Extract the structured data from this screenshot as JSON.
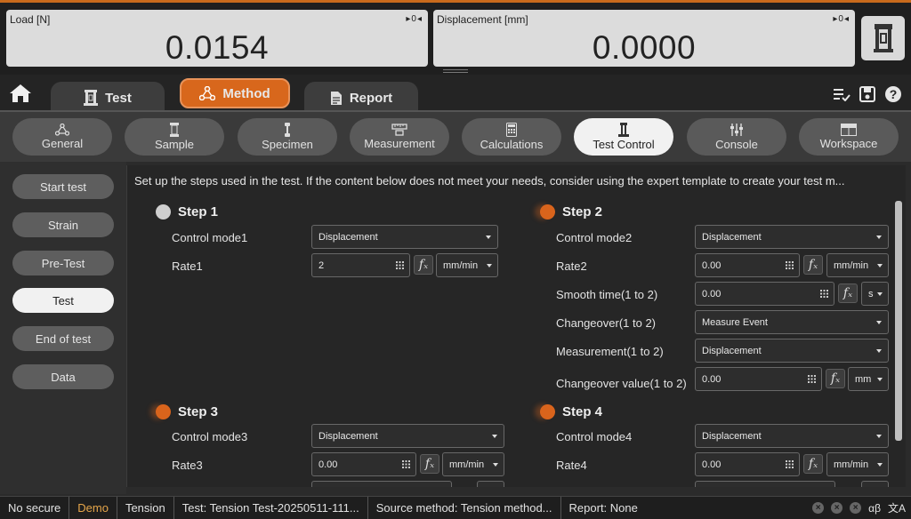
{
  "readouts": {
    "load": {
      "label": "Load [N]",
      "value": "0.0154",
      "controls": "▸0◂"
    },
    "displacement": {
      "label": "Displacement [mm]",
      "value": "0.0000",
      "controls": "▸0◂"
    }
  },
  "main_tabs": [
    {
      "label": "Test",
      "icon": "test-machine-icon",
      "active": false
    },
    {
      "label": "Method",
      "icon": "method-icon",
      "active": true
    },
    {
      "label": "Report",
      "icon": "report-icon",
      "active": false
    }
  ],
  "sub_tabs": [
    {
      "label": "General",
      "icon": "general-icon"
    },
    {
      "label": "Sample",
      "icon": "sample-icon"
    },
    {
      "label": "Specimen",
      "icon": "specimen-icon"
    },
    {
      "label": "Measurement",
      "icon": "measurement-icon"
    },
    {
      "label": "Calculations",
      "icon": "calculator-icon"
    },
    {
      "label": "Test Control",
      "icon": "test-control-icon",
      "active": true
    },
    {
      "label": "Console",
      "icon": "console-icon"
    },
    {
      "label": "Workspace",
      "icon": "workspace-icon"
    }
  ],
  "left_nav": [
    {
      "label": "Start test"
    },
    {
      "label": "Strain"
    },
    {
      "label": "Pre-Test"
    },
    {
      "label": "Test",
      "active": true
    },
    {
      "label": "End of test"
    },
    {
      "label": "Data"
    }
  ],
  "description": "Set up the steps used in the test. If the content below does not meet your needs, consider using the expert template to create your test m...",
  "steps": {
    "step1": {
      "title": "Step 1",
      "control_mode_label": "Control mode1",
      "control_mode_value": "Displacement",
      "rate_label": "Rate1",
      "rate_value": "2",
      "rate_unit": "mm/min"
    },
    "step2": {
      "title": "Step 2",
      "control_mode_label": "Control mode2",
      "control_mode_value": "Displacement",
      "rate_label": "Rate2",
      "rate_value": "0.00",
      "rate_unit": "mm/min",
      "smooth_label": "Smooth time(1 to 2)",
      "smooth_value": "0.00",
      "smooth_unit": "s",
      "changeover_label": "Changeover(1 to 2)",
      "changeover_value": "Measure Event",
      "measurement_label": "Measurement(1 to 2)",
      "measurement_value": "Displacement",
      "changeover_val_label": "Changeover value(1 to 2)",
      "changeover_val_value": "0.00",
      "changeover_val_unit": "mm"
    },
    "step3": {
      "title": "Step 3",
      "control_mode_label": "Control mode3",
      "control_mode_value": "Displacement",
      "rate_label": "Rate3",
      "rate_value": "0.00",
      "rate_unit": "mm/min"
    },
    "step4": {
      "title": "Step 4",
      "control_mode_label": "Control mode4",
      "control_mode_value": "Displacement",
      "rate_label": "Rate4",
      "rate_value": "0.00",
      "rate_unit": "mm/min"
    }
  },
  "fx_label": "f",
  "status_bar": {
    "security": "No secure",
    "mode": "Demo",
    "type": "Tension",
    "test": "Test: Tension Test-20250511-111...",
    "source": "Source method: Tension method...",
    "report": "Report: None",
    "lang_short": "αβ",
    "translate": "文A"
  },
  "colors": {
    "accent": "#d8671c",
    "background": "#2b2b2b",
    "readout_bg": "#dcdcdc",
    "demo_text": "#e6a64a"
  }
}
